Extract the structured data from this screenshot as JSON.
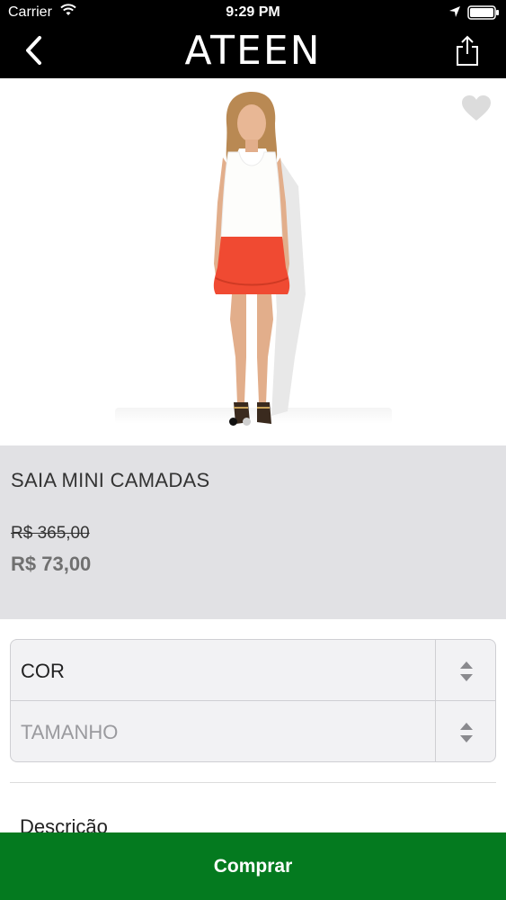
{
  "status_bar": {
    "carrier": "Carrier",
    "time": "9:29 PM",
    "icons": [
      "wifi-icon",
      "location-icon",
      "battery-icon"
    ]
  },
  "nav": {
    "back_icon": "chevron-left-icon",
    "brand": "ATEEN",
    "share_icon": "share-icon"
  },
  "gallery": {
    "favorite_icon": "heart-icon",
    "image_count": 2,
    "active_index": 0
  },
  "product": {
    "name": "SAIA MINI CAMADAS",
    "old_price": "R$ 365,00",
    "price": "R$ 73,00"
  },
  "options": {
    "color_label": "COR",
    "size_label": "TAMANHO"
  },
  "description": {
    "title": "Descrição"
  },
  "actions": {
    "buy_label": "Comprar"
  },
  "colors": {
    "nav_bg": "#000000",
    "info_bg": "#e1e1e4",
    "buy_bg": "#047a1f",
    "skirt": "#f04a32"
  }
}
